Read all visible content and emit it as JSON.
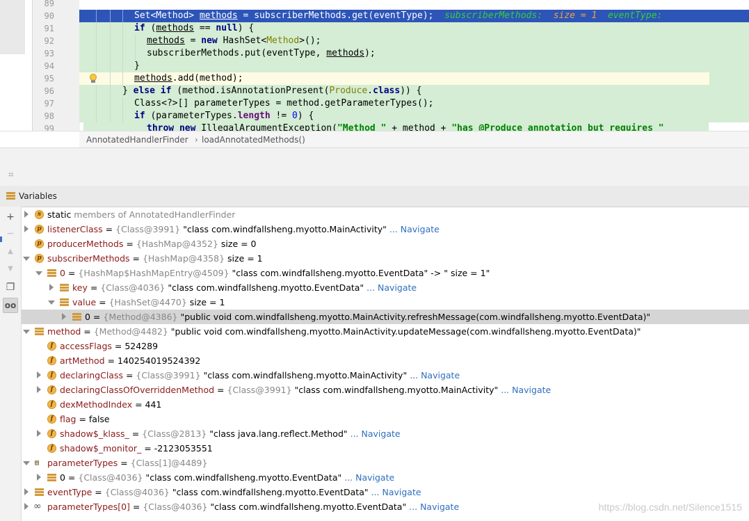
{
  "editor": {
    "lines": [
      {
        "n": "89"
      },
      {
        "n": "90"
      },
      {
        "n": "91"
      },
      {
        "n": "92"
      },
      {
        "n": "93"
      },
      {
        "n": "94"
      },
      {
        "n": "95"
      },
      {
        "n": "96"
      },
      {
        "n": "97"
      },
      {
        "n": "98"
      },
      {
        "n": "99"
      }
    ],
    "code": {
      "l90_a": "Set<Method> ",
      "l90_b": "methods",
      "l90_c": " = subscriberMethods.get(eventType);  ",
      "l90_dbg1": "subscriberMethods:  ",
      "l90_dbg2": "size = 1  ",
      "l90_dbg3": "eventType:",
      "l91_kw": "if",
      "l91_a": " (",
      "l91_b": "methods",
      "l91_c": " == ",
      "l91_kw2": "null",
      "l91_d": ") {",
      "l92_a": "methods",
      "l92_b": " = ",
      "l92_kw": "new",
      "l92_c": " HashSet<",
      "l92_gen": "Method",
      "l92_d": ">();",
      "l93_a": "subscriberMethods.put(eventType, ",
      "l93_b": "methods",
      "l93_c": ");",
      "l94_a": "}",
      "l95_a": "methods",
      "l95_b": ".add(method);",
      "l96_a": "} ",
      "l96_kw": "else if",
      "l96_b": " (method.isAnnotationPresent(",
      "l96_gen": "Produce",
      "l96_c": ".",
      "l96_kw2": "class",
      "l96_d": ")) {",
      "l97_a": "Class<?>[] parameterTypes = method.getParameterTypes();",
      "l98_kw": "if",
      "l98_a": " (parameterTypes.",
      "l98_field": "length",
      "l98_b": " != ",
      "l98_num": "0",
      "l98_c": ") {",
      "l99_kw": "throw new",
      "l99_a": " IllegalArgumentException(",
      "l99_str": "\"Method \"",
      "l99_b": " + method + ",
      "l99_str2": "\"has @Produce annotation but requires \""
    }
  },
  "breadcrumb": {
    "class_name": "AnnotatedHandlerFinder",
    "separator": "›",
    "method_name": "loadAnnotatedMethods()"
  },
  "variables_panel": {
    "title": "Variables",
    "toolbar": [
      {
        "icon": "plus-icon",
        "glyph": "+"
      },
      {
        "icon": "minus-icon",
        "glyph": "−"
      },
      {
        "icon": "up-icon",
        "glyph": "▲"
      },
      {
        "icon": "down-icon",
        "glyph": "▼"
      },
      {
        "icon": "copy-icon",
        "glyph": "❐"
      },
      {
        "icon": "glasses-icon",
        "glyph": "oo"
      }
    ],
    "rows": [
      {
        "name": "static",
        "rest": " members of AnnotatedHandlerFinder"
      },
      {
        "name": "listenerClass",
        "eq": " = ",
        "ref": "{Class@3991}",
        "val": " \"class com.windfallsheng.myotto.MainActivity\"",
        "nav": " ... Navigate"
      },
      {
        "name": "producerMethods",
        "eq": " = ",
        "ref": "{HashMap@4352}",
        "val": "  size = 0"
      },
      {
        "name": "subscriberMethods",
        "eq": " = ",
        "ref": "{HashMap@4358}",
        "val": "  size = 1"
      },
      {
        "name": "0",
        "eq": " = ",
        "ref": "{HashMap$HashMapEntry@4509}",
        "val": " \"class com.windfallsheng.myotto.EventData\" -> \" size = 1\""
      },
      {
        "name": "key",
        "eq": " = ",
        "ref": "{Class@4036}",
        "val": " \"class com.windfallsheng.myotto.EventData\"",
        "nav": " ... Navigate"
      },
      {
        "name": "value",
        "eq": " = ",
        "ref": "{HashSet@4470}",
        "val": "  size = 1"
      },
      {
        "name": "0",
        "eq": " = ",
        "ref": "{Method@4386}",
        "val": " \"public void com.windfallsheng.myotto.MainActivity.refreshMessage(com.windfallsheng.myotto.EventData)\""
      },
      {
        "name": "method",
        "eq": " = ",
        "ref": "{Method@4482}",
        "val": " \"public void com.windfallsheng.myotto.MainActivity.updateMessage(com.windfallsheng.myotto.EventData)\""
      },
      {
        "name": "accessFlags",
        "eq": " = ",
        "val": "524289"
      },
      {
        "name": "artMethod",
        "eq": " = ",
        "val": "140254019524392"
      },
      {
        "name": "declaringClass",
        "eq": " = ",
        "ref": "{Class@3991}",
        "val": " \"class com.windfallsheng.myotto.MainActivity\"",
        "nav": " ... Navigate"
      },
      {
        "name": "declaringClassOfOverriddenMethod",
        "eq": " = ",
        "ref": "{Class@3991}",
        "val": " \"class com.windfallsheng.myotto.MainActivity\"",
        "nav": " ... Navigate"
      },
      {
        "name": "dexMethodIndex",
        "eq": " = ",
        "val": "441"
      },
      {
        "name": "flag",
        "eq": " = ",
        "val": "false"
      },
      {
        "name": "shadow$_klass_",
        "eq": " = ",
        "ref": "{Class@2813}",
        "val": " \"class java.lang.reflect.Method\"",
        "nav": " ... Navigate"
      },
      {
        "name": "shadow$_monitor_",
        "eq": " = ",
        "val": "-2123053551"
      },
      {
        "name": "parameterTypes",
        "eq": " = ",
        "ref": "{Class[1]@4489}"
      },
      {
        "name": "0",
        "eq": " = ",
        "ref": "{Class@4036}",
        "val": " \"class com.windfallsheng.myotto.EventData\"",
        "nav": " ... Navigate"
      },
      {
        "name": "eventType",
        "eq": " = ",
        "ref": "{Class@4036}",
        "val": " \"class com.windfallsheng.myotto.EventData\"",
        "nav": " ... Navigate"
      },
      {
        "name": "parameterTypes[0]",
        "eq": " = ",
        "ref": "{Class@4036}",
        "val": " \"class com.windfallsheng.myotto.EventData\"",
        "nav": " ... Navigate"
      }
    ]
  },
  "watermark": "https://blog.csdn.net/Silence1515",
  "colors": {
    "execution_line": "#2d55b8",
    "highlight_block": "#d4edd4",
    "link": "#2f6fbd",
    "field_badge": "#f0b64c"
  }
}
